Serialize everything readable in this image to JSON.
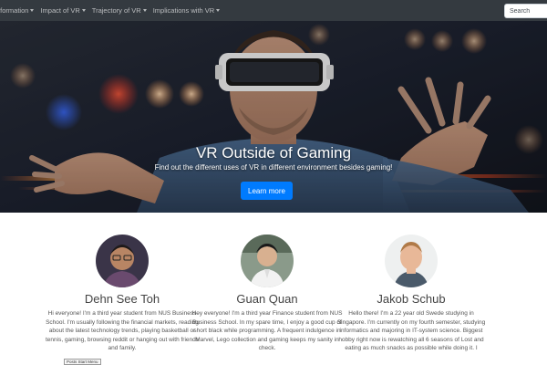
{
  "nav": {
    "items": [
      {
        "label": "nformation"
      },
      {
        "label": "Impact of VR"
      },
      {
        "label": "Trajectory of VR"
      },
      {
        "label": "Implications with VR"
      }
    ],
    "search_placeholder": "Search"
  },
  "hero": {
    "title": "VR Outside of Gaming",
    "subtitle": "Find out the different uses of VR in different environment besides gaming!",
    "button_label": "Learn more",
    "slide_count": 3,
    "active_slide": 2
  },
  "team": [
    {
      "name": "Dehn See Toh",
      "bio": "Hi everyone! I'm a third year student from NUS Business School. I'm usually following the financial markets, reading about the latest technology trends, playing basketball or tennis, gaming, browsing reddit or hanging out with friends and family."
    },
    {
      "name": "Guan Quan",
      "bio": "Hey everyone! I'm a third year Finance student from NUS Business School. In my spare time, I enjoy a good cup of short black while programming. A frequent indulgence in Marvel, Lego collection and gaming keeps my sanity in check."
    },
    {
      "name": "Jakob Schub",
      "bio": "Hello there! I'm a 22 year old Swede studying in Singapore. I'm currently on my fourth semester, studying informatics and majoring in IT-system science. Biggest hobby right now is rewatching all 6 seasons of Lost and eating as much snacks as possible while doing it. I"
    }
  ],
  "tooltip": {
    "text": "Posts Start Menu"
  },
  "colors": {
    "navbar": "#343a40",
    "button": "#007bff"
  }
}
